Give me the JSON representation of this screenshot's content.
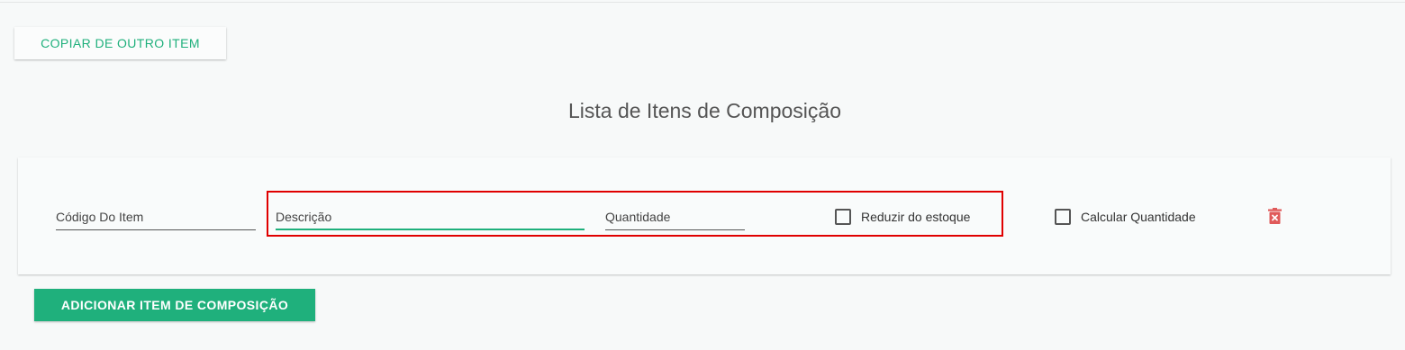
{
  "toolbar": {
    "copy_label": "COPIAR DE OUTRO ITEM"
  },
  "section": {
    "title": "Lista de Itens de Composição"
  },
  "composition_item": {
    "code_placeholder": "Código Do Item",
    "description_placeholder": "Descrição",
    "quantity_placeholder": "Quantidade",
    "reduce_stock_label": "Reduzir do estoque",
    "reduce_stock_checked": false,
    "calc_quantity_label": "Calcular Quantidade",
    "calc_quantity_checked": false,
    "delete_icon": "trash-icon"
  },
  "actions": {
    "add_label": "ADICIONAR ITEM DE COMPOSIÇÃO"
  },
  "colors": {
    "accent": "#1fb07c",
    "delete": "#e05a5a",
    "highlight": "#e00000"
  }
}
